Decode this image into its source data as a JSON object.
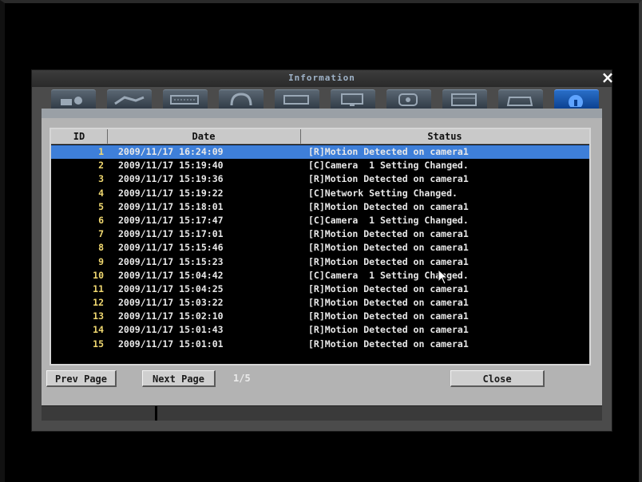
{
  "window": {
    "title": "Information",
    "close_label": "×"
  },
  "toolbar": {
    "icons": [
      "camera-settings-icon",
      "display-icon",
      "keyboard-icon",
      "alarm-icon",
      "record-icon",
      "monitor-icon",
      "network-icon",
      "schedule-icon",
      "gamepad-icon",
      "information-icon"
    ],
    "active_index": 9
  },
  "table": {
    "headers": {
      "id": "ID",
      "date": "Date",
      "status": "Status"
    },
    "rows": [
      {
        "id": "1",
        "date": "2009/11/17 16:24:09",
        "status": "[R]Motion Detected on camera1",
        "selected": true
      },
      {
        "id": "2",
        "date": "2009/11/17 15:19:40",
        "status": "[C]Camera  1 Setting Changed."
      },
      {
        "id": "3",
        "date": "2009/11/17 15:19:36",
        "status": "[R]Motion Detected on camera1"
      },
      {
        "id": "4",
        "date": "2009/11/17 15:19:22",
        "status": "[C]Network Setting Changed."
      },
      {
        "id": "5",
        "date": "2009/11/17 15:18:01",
        "status": "[R]Motion Detected on camera1"
      },
      {
        "id": "6",
        "date": "2009/11/17 15:17:47",
        "status": "[C]Camera  1 Setting Changed."
      },
      {
        "id": "7",
        "date": "2009/11/17 15:17:01",
        "status": "[R]Motion Detected on camera1"
      },
      {
        "id": "8",
        "date": "2009/11/17 15:15:46",
        "status": "[R]Motion Detected on camera1"
      },
      {
        "id": "9",
        "date": "2009/11/17 15:15:23",
        "status": "[R]Motion Detected on camera1"
      },
      {
        "id": "10",
        "date": "2009/11/17 15:04:42",
        "status": "[C]Camera  1 Setting Changed."
      },
      {
        "id": "11",
        "date": "2009/11/17 15:04:25",
        "status": "[R]Motion Detected on camera1"
      },
      {
        "id": "12",
        "date": "2009/11/17 15:03:22",
        "status": "[R]Motion Detected on camera1"
      },
      {
        "id": "13",
        "date": "2009/11/17 15:02:10",
        "status": "[R]Motion Detected on camera1"
      },
      {
        "id": "14",
        "date": "2009/11/17 15:01:43",
        "status": "[R]Motion Detected on camera1"
      },
      {
        "id": "15",
        "date": "2009/11/17 15:01:01",
        "status": "[R]Motion Detected on camera1"
      }
    ]
  },
  "footer": {
    "prev_label": "Prev Page",
    "next_label": "Next Page",
    "page_info": "1/5",
    "close_label": "Close"
  },
  "colors": {
    "selection": "#3e7fd9",
    "id_text": "#f0d870",
    "active_tab": "#0a3f8f"
  }
}
